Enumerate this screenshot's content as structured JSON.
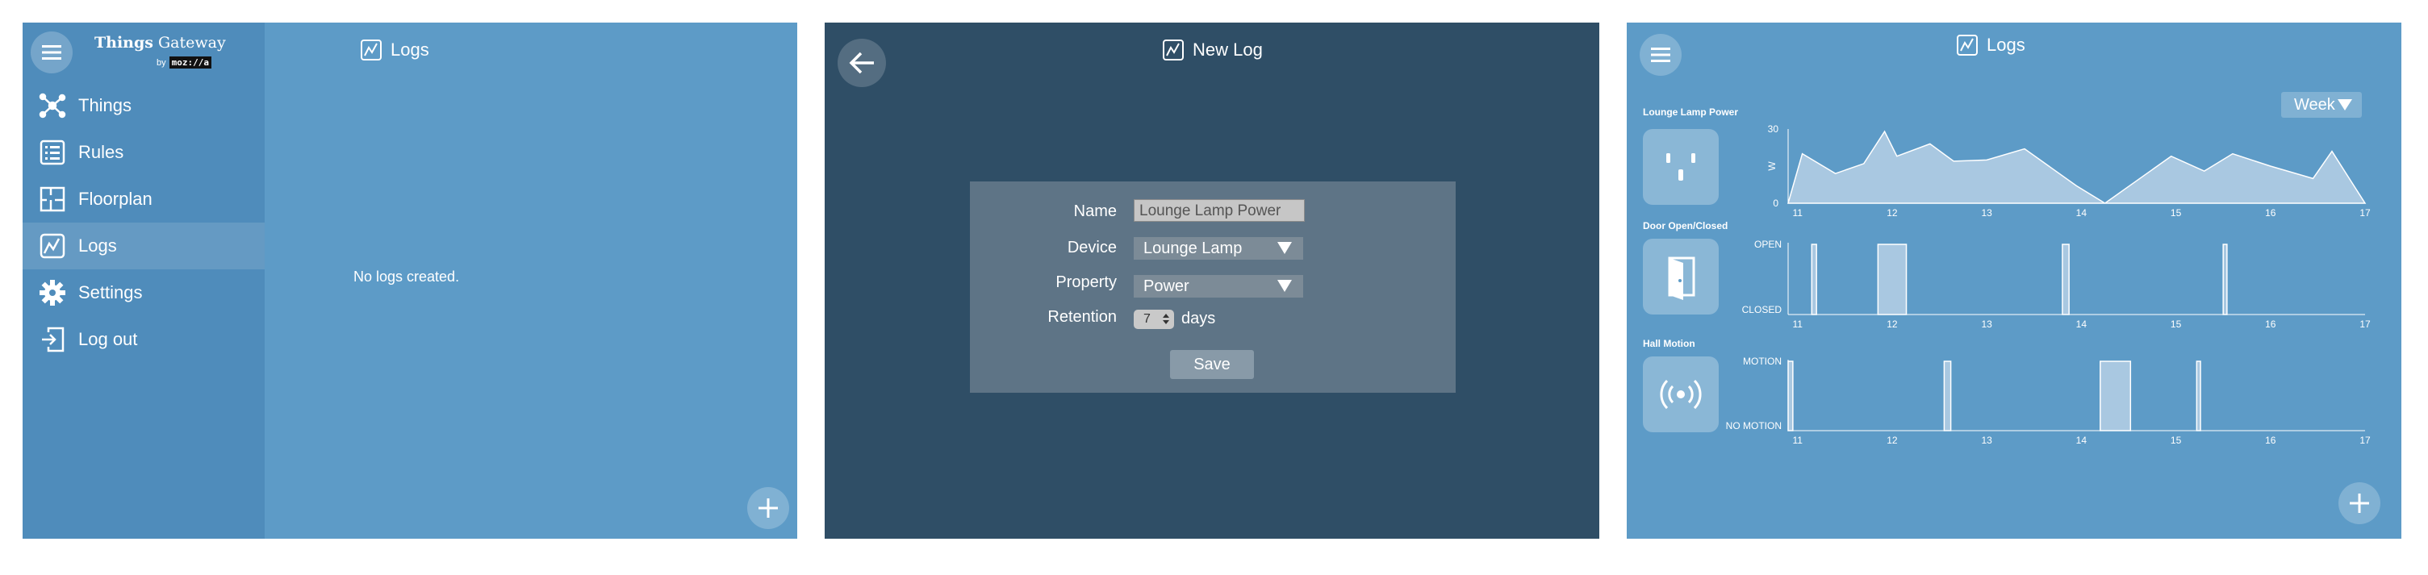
{
  "panel1": {
    "brand": {
      "name_bold": "Things",
      "name_rest": " Gateway",
      "by": "by",
      "mozilla": "moz://a"
    },
    "title": "Logs",
    "nav": [
      {
        "label": "Things",
        "icon": "things-icon"
      },
      {
        "label": "Rules",
        "icon": "rules-icon"
      },
      {
        "label": "Floorplan",
        "icon": "floorplan-icon"
      },
      {
        "label": "Logs",
        "icon": "logs-icon",
        "active": true
      },
      {
        "label": "Settings",
        "icon": "gear-icon"
      },
      {
        "label": "Log out",
        "icon": "logout-icon"
      }
    ],
    "empty_message": "No logs created.",
    "add_icon": "plus-icon"
  },
  "panel2": {
    "title": "New Log",
    "back_icon": "back-arrow-icon",
    "form": {
      "name_label": "Name",
      "name_value": "Lounge Lamp Power",
      "device_label": "Device",
      "device_value": "Lounge Lamp",
      "property_label": "Property",
      "property_value": "Power",
      "retention_label": "Retention",
      "retention_value": "7",
      "retention_unit": "days",
      "save_label": "Save"
    }
  },
  "panel3": {
    "title": "Logs",
    "range": "Week",
    "colors": {
      "panel_bg": "#5d9bc7",
      "fill": "#a9c8e1"
    },
    "logs": [
      {
        "name": "Lounge Lamp Power",
        "icon": "outlet-icon"
      },
      {
        "name": "Door Open/Closed",
        "icon": "door-icon"
      },
      {
        "name": "Hall Motion",
        "icon": "motion-icon"
      }
    ],
    "add_icon": "plus-icon"
  },
  "chart_data": [
    {
      "type": "area",
      "title": "Lounge Lamp Power",
      "xlabel": "",
      "ylabel": "W",
      "x_ticks": [
        "11",
        "12",
        "13",
        "14",
        "15",
        "16",
        "17"
      ],
      "y_ticks": [
        "0",
        "30"
      ],
      "ylim": [
        0,
        30
      ],
      "xlim": [
        10.9,
        17
      ],
      "x": [
        10.9,
        11.05,
        11.4,
        11.7,
        11.92,
        12.05,
        12.4,
        12.65,
        13.0,
        13.4,
        13.95,
        14.25,
        14.95,
        15.3,
        15.6,
        16.0,
        16.45,
        16.65,
        17.0
      ],
      "y": [
        0,
        20,
        12,
        16,
        29,
        19,
        24,
        17,
        17.5,
        22,
        7,
        0,
        19,
        13,
        20,
        15,
        10,
        21,
        0
      ]
    },
    {
      "type": "area",
      "title": "Door Open/Closed",
      "x_ticks": [
        "11",
        "12",
        "13",
        "14",
        "15",
        "16",
        "17"
      ],
      "y_ticks": [
        "CLOSED",
        "OPEN"
      ],
      "xlim": [
        10.9,
        17
      ],
      "segments": [
        [
          11.15,
          11.2
        ],
        [
          11.85,
          12.15
        ],
        [
          13.8,
          13.87
        ],
        [
          15.5,
          15.54
        ]
      ]
    },
    {
      "type": "area",
      "title": "Hall Motion",
      "x_ticks": [
        "11",
        "12",
        "13",
        "14",
        "15",
        "16",
        "17"
      ],
      "y_ticks": [
        "NO MOTION",
        "MOTION"
      ],
      "xlim": [
        10.9,
        17
      ],
      "segments": [
        [
          10.9,
          10.95
        ],
        [
          12.55,
          12.62
        ],
        [
          14.2,
          14.52
        ],
        [
          15.22,
          15.26
        ]
      ]
    }
  ]
}
